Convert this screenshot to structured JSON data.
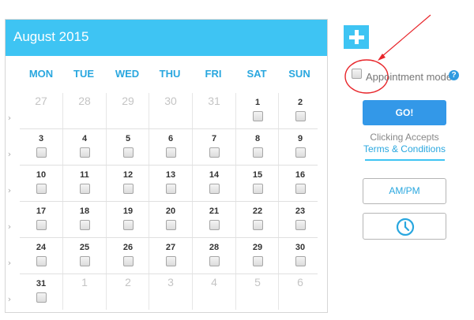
{
  "calendar": {
    "title": "August 2015",
    "days_of_week": [
      "MON",
      "TUE",
      "WED",
      "THU",
      "FRI",
      "SAT",
      "SUN"
    ],
    "weeks": [
      [
        {
          "n": "27",
          "cur": false
        },
        {
          "n": "28",
          "cur": false
        },
        {
          "n": "29",
          "cur": false
        },
        {
          "n": "30",
          "cur": false
        },
        {
          "n": "31",
          "cur": false
        },
        {
          "n": "1",
          "cur": true
        },
        {
          "n": "2",
          "cur": true
        }
      ],
      [
        {
          "n": "3",
          "cur": true
        },
        {
          "n": "4",
          "cur": true
        },
        {
          "n": "5",
          "cur": true
        },
        {
          "n": "6",
          "cur": true
        },
        {
          "n": "7",
          "cur": true
        },
        {
          "n": "8",
          "cur": true
        },
        {
          "n": "9",
          "cur": true
        }
      ],
      [
        {
          "n": "10",
          "cur": true
        },
        {
          "n": "11",
          "cur": true
        },
        {
          "n": "12",
          "cur": true
        },
        {
          "n": "13",
          "cur": true
        },
        {
          "n": "14",
          "cur": true
        },
        {
          "n": "15",
          "cur": true
        },
        {
          "n": "16",
          "cur": true
        }
      ],
      [
        {
          "n": "17",
          "cur": true
        },
        {
          "n": "18",
          "cur": true
        },
        {
          "n": "19",
          "cur": true
        },
        {
          "n": "20",
          "cur": true
        },
        {
          "n": "21",
          "cur": true
        },
        {
          "n": "22",
          "cur": true
        },
        {
          "n": "23",
          "cur": true
        }
      ],
      [
        {
          "n": "24",
          "cur": true
        },
        {
          "n": "25",
          "cur": true
        },
        {
          "n": "26",
          "cur": true
        },
        {
          "n": "27",
          "cur": true
        },
        {
          "n": "28",
          "cur": true
        },
        {
          "n": "29",
          "cur": true
        },
        {
          "n": "30",
          "cur": true
        }
      ],
      [
        {
          "n": "31",
          "cur": true
        },
        {
          "n": "1",
          "cur": false
        },
        {
          "n": "2",
          "cur": false
        },
        {
          "n": "3",
          "cur": false
        },
        {
          "n": "4",
          "cur": false
        },
        {
          "n": "5",
          "cur": false
        },
        {
          "n": "6",
          "cur": false
        }
      ]
    ],
    "row_arrow_icon": "chevron-right-icon"
  },
  "sidebar": {
    "add_icon": "plus-icon",
    "appointment_label": "Appointment mode",
    "help_icon": "?",
    "go_label": "GO!",
    "clicking_text": "Clicking Accepts",
    "terms_link": "Terms & Conditions",
    "ampm_label": "AM/PM",
    "clock_icon": "clock-icon"
  },
  "annotation": {
    "color": "#e8262b",
    "shapes": [
      "arrow",
      "circle"
    ]
  },
  "colors": {
    "accent": "#3ec4f3",
    "header_text": "#29a7df",
    "go_button": "#3398e8"
  }
}
